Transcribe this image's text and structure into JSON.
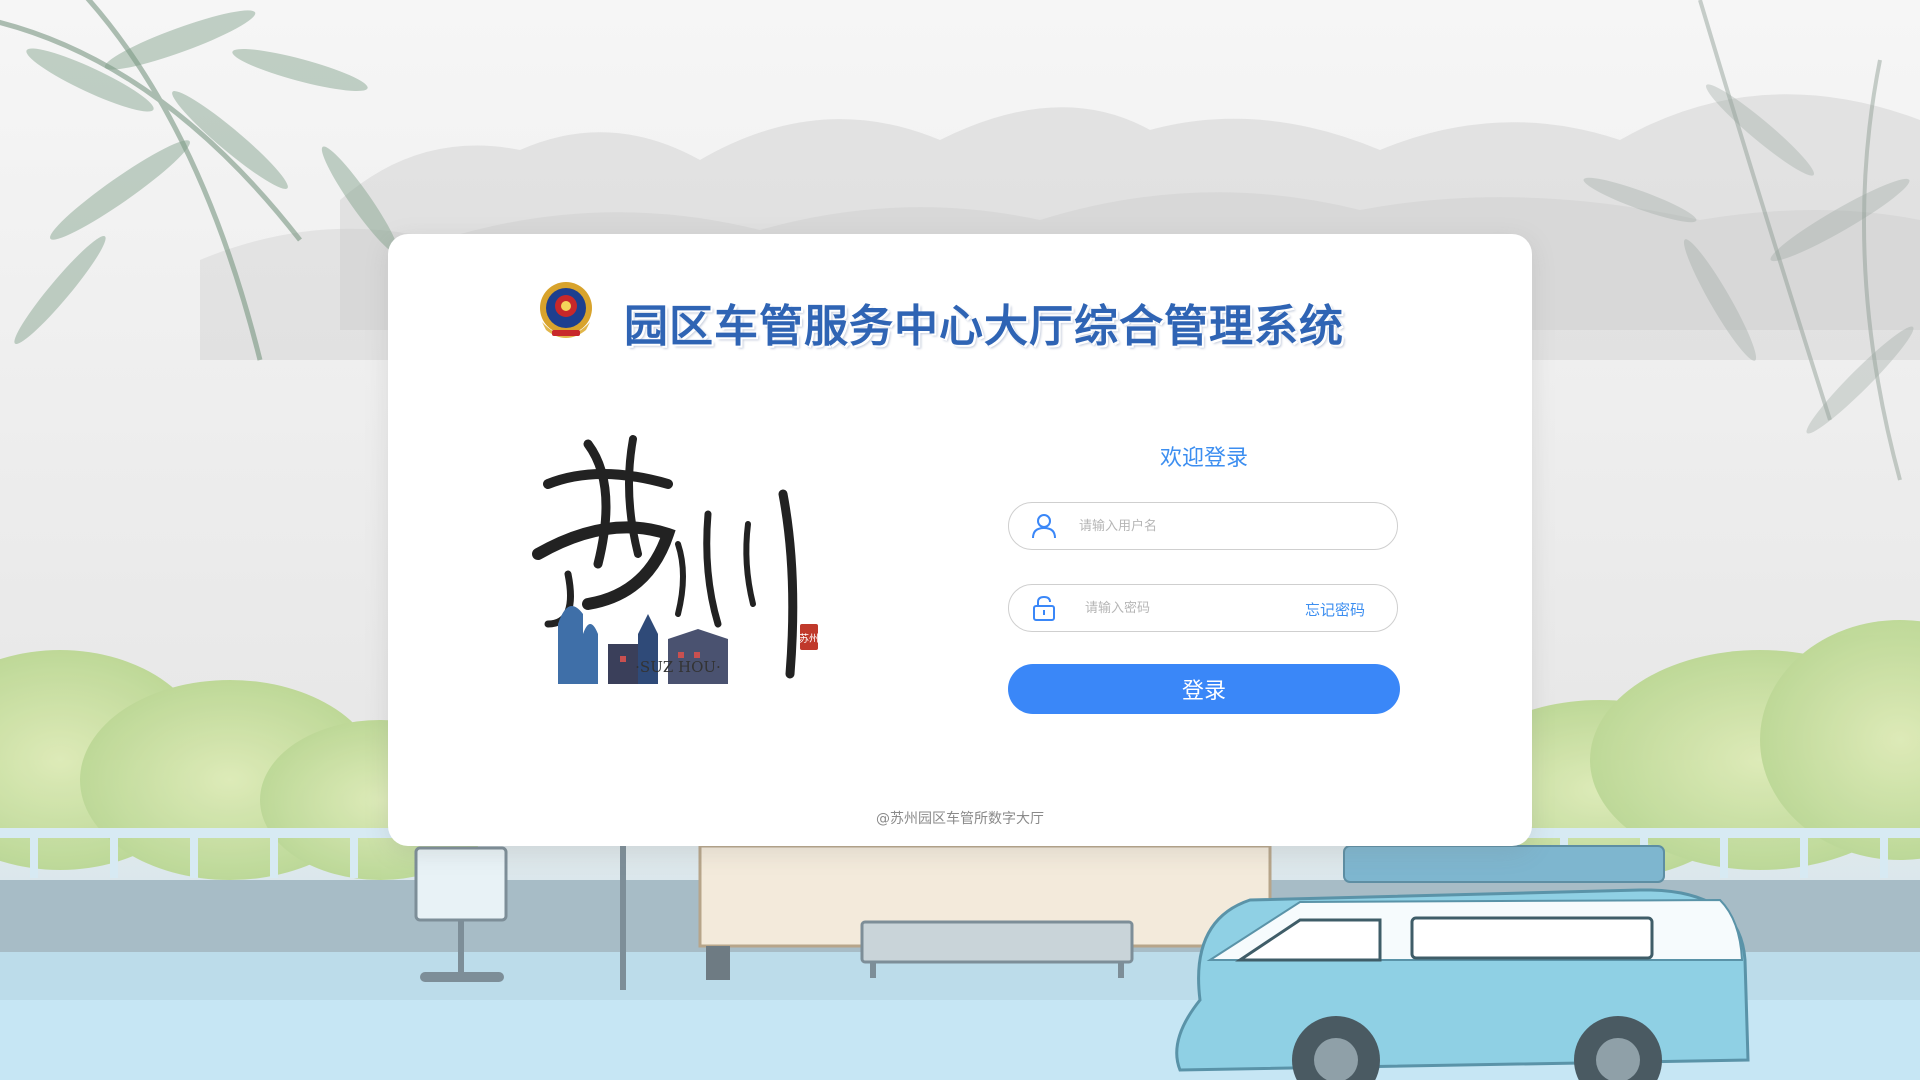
{
  "app": {
    "title": "园区车管服务中心大厅综合管理系统",
    "emblem_icon": "police-emblem-icon"
  },
  "city_art": {
    "calligraphy": "苏州",
    "romanized": "·SUZ HOU·",
    "seal_text": "苏州"
  },
  "login": {
    "welcome": "欢迎登录",
    "username": {
      "placeholder": "请输入用户名",
      "value": "",
      "icon": "user-icon"
    },
    "password": {
      "placeholder": "请输入密码",
      "value": "",
      "icon": "lock-icon"
    },
    "forgot_label": "忘记密码",
    "submit_label": "登录"
  },
  "footer": {
    "copyright": "@苏州园区车管所数字大厅"
  },
  "colors": {
    "accent": "#3a87f8",
    "link": "#3c8ef0",
    "title": "#2f64b4",
    "card": "#ffffff"
  }
}
